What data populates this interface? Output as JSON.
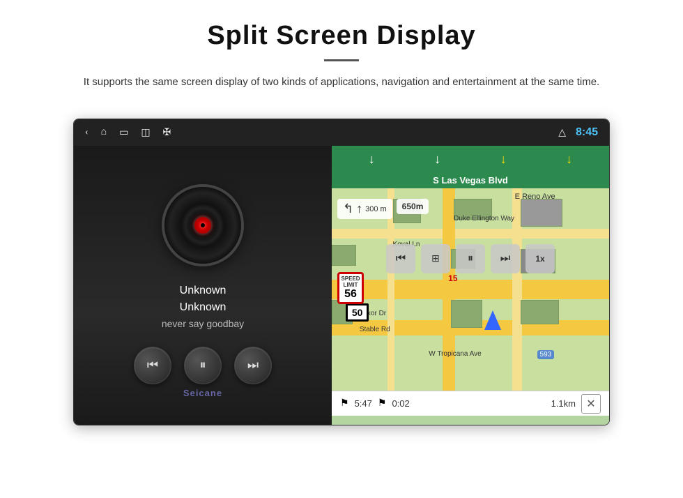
{
  "header": {
    "title": "Split Screen Display",
    "divider": true,
    "description": "It supports the same screen display of two kinds of applications, navigation and entertainment at the same time."
  },
  "status_bar": {
    "time": "8:45",
    "icons": [
      "back-arrow",
      "home",
      "apps",
      "image",
      "usb",
      "eject"
    ]
  },
  "media_panel": {
    "track_title": "Unknown",
    "track_artist": "Unknown",
    "track_song": "never say goodbay",
    "controls": {
      "prev": "⏮",
      "play": "⏸",
      "next": "⏭"
    }
  },
  "nav_panel": {
    "street": "S Las Vegas Blvd",
    "arrows": [
      "↓",
      "↓",
      "↓",
      "↓"
    ],
    "direction": {
      "turn": "←",
      "straight": "↑",
      "dist_label": "300 m"
    },
    "dist_side": "650m",
    "playback_controls": [
      "⏮",
      "⏸",
      "⏭",
      "1x"
    ],
    "speed_limit": {
      "label": "SPEED LIMIT",
      "value": "56"
    },
    "bottom_bar": {
      "time": "5:47",
      "duration": "0:02",
      "distance": "1.1km"
    },
    "highway_num": "50"
  }
}
